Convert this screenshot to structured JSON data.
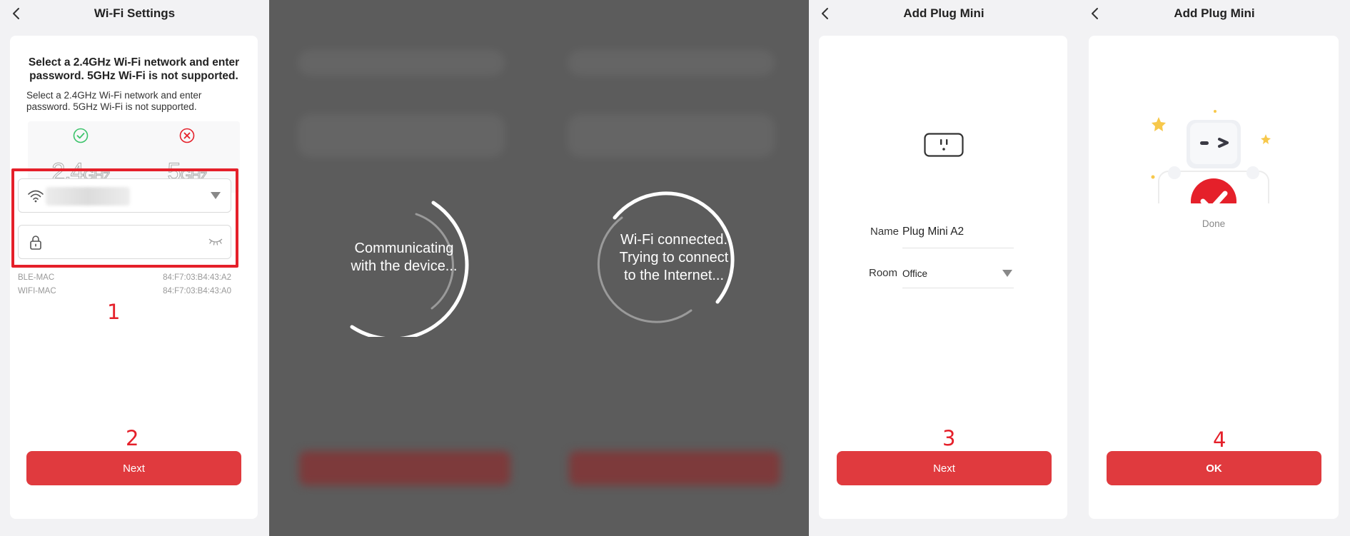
{
  "panel1": {
    "title": "Wi-Fi Settings",
    "headline": "Select a 2.4GHz Wi-Fi network and enter password. 5GHz Wi-Fi is not supported.",
    "subtext": "Select a 2.4GHz Wi-Fi network and enter password. 5GHz Wi-Fi is not supported.",
    "freq_supported": {
      "big": "2.4",
      "unit": "GHz"
    },
    "freq_unsupported": {
      "big": "5",
      "unit": "GHz"
    },
    "ssid_value": "",
    "password_value": "",
    "ble_mac_label": "BLE-MAC",
    "ble_mac_value": "84:F7:03:B4:43:A2",
    "wifi_mac_label": "WIFI-MAC",
    "wifi_mac_value": "84:F7:03:B4:43:A0",
    "step_fields": "1",
    "step_next": "2",
    "next_label": "Next"
  },
  "panel2": {
    "loading_line1": "Communicating",
    "loading_line2": "with the device..."
  },
  "panel3": {
    "loading_line1": "Wi-Fi connected.",
    "loading_line2": "Trying to connect",
    "loading_line3": "to the Internet..."
  },
  "panel4": {
    "title": "Add Plug Mini",
    "name_label": "Name",
    "name_value": "Plug Mini A2",
    "room_label": "Room",
    "room_value": "Office",
    "step_next": "3",
    "next_label": "Next"
  },
  "panel5": {
    "title": "Add Plug Mini",
    "done_label": "Done",
    "step_ok": "4",
    "ok_label": "OK"
  },
  "colors": {
    "accent": "#e03a3e",
    "highlight": "#e5202a",
    "success": "#3cc36b",
    "error": "#e5202a",
    "overlay": "#5c5c5c"
  },
  "icons": [
    "back-icon",
    "check-circle-icon",
    "x-circle-icon",
    "wifi-icon",
    "lock-icon",
    "eye-closed-icon",
    "chevron-down-icon",
    "smart-plug-icon",
    "robot-success-icon"
  ]
}
